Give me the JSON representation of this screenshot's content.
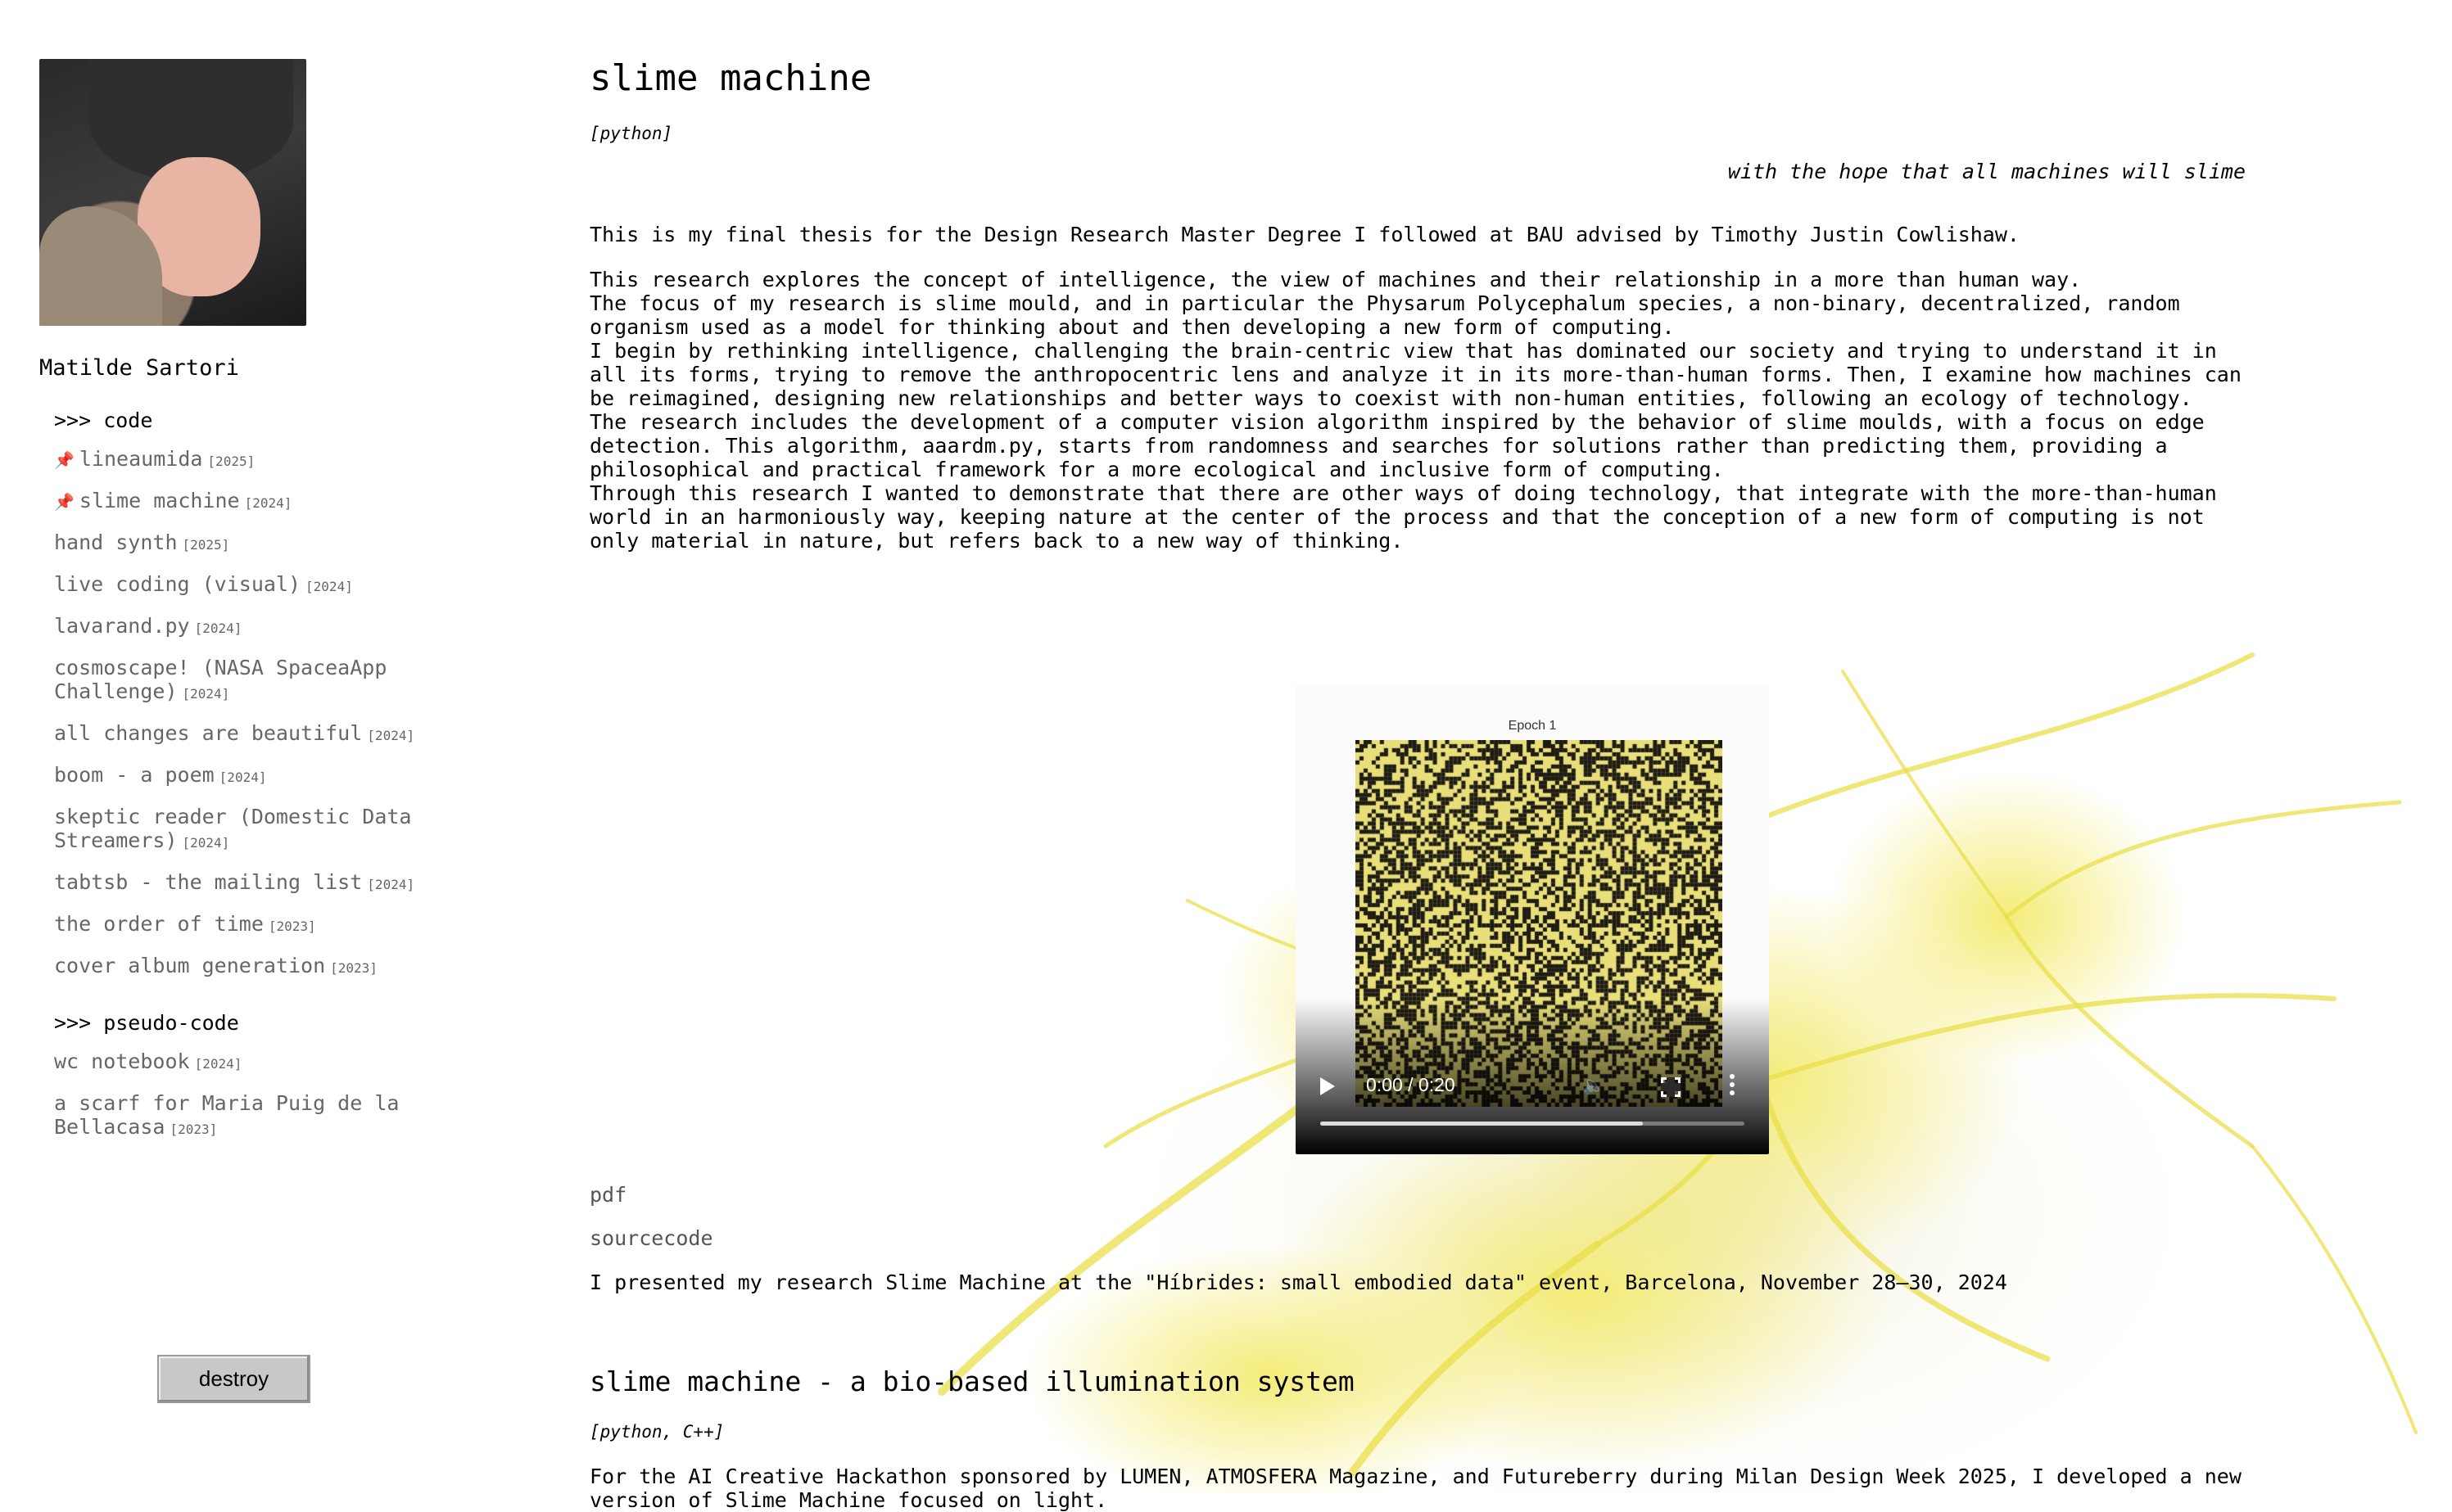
{
  "author": {
    "name": "Matilde Sartori"
  },
  "sidebar": {
    "sections": [
      {
        "heading": ">>> code",
        "items": [
          {
            "label": "lineaumida",
            "year": "[2025]",
            "pinned": true
          },
          {
            "label": "slime machine",
            "year": "[2024]",
            "pinned": true
          },
          {
            "label": "hand synth",
            "year": "[2025]",
            "pinned": false
          },
          {
            "label": "live coding (visual)",
            "year": "[2024]",
            "pinned": false
          },
          {
            "label": "lavarand.py",
            "year": "[2024]",
            "pinned": false
          },
          {
            "label": "cosmoscape! (NASA SpaceaApp Challenge)",
            "year": "[2024]",
            "pinned": false
          },
          {
            "label": "all changes are beautiful",
            "year": "[2024]",
            "pinned": false
          },
          {
            "label": "boom - a poem",
            "year": "[2024]",
            "pinned": false
          },
          {
            "label": "skeptic reader (Domestic Data Streamers)",
            "year": "[2024]",
            "pinned": false
          },
          {
            "label": "tabtsb - the mailing list",
            "year": "[2024]",
            "pinned": false
          },
          {
            "label": "the order of time",
            "year": "[2023]",
            "pinned": false
          },
          {
            "label": "cover album generation",
            "year": "[2023]",
            "pinned": false
          }
        ]
      },
      {
        "heading": ">>> pseudo-code",
        "items": [
          {
            "label": "wc notebook",
            "year": "[2024]",
            "pinned": false
          },
          {
            "label": "a scarf for Maria Puig de la Bellacasa",
            "year": "[2023]",
            "pinned": false
          }
        ]
      }
    ],
    "destroy_label": "destroy"
  },
  "project": {
    "title": "slime machine",
    "languages": "[python]",
    "quote": "with the hope that all machines will slime",
    "intro": "This is my final thesis for the Design Research Master Degree I followed at BAU advised by Timothy Justin Cowlishaw.",
    "paragraphs": [
      "This research explores the concept of intelligence, the view of machines and their relationship in a more than human way.",
      "The focus of my research is slime mould, and in particular the Physarum Polycephalum species, a non-binary, decentralized, random organism used as a model for thinking about and then developing a new form of computing.",
      "I begin by rethinking intelligence, challenging the brain-centric view that has dominated our society and trying to understand it in all its forms, trying to remove the anthropocentric lens and analyze it in its more-than-human forms. Then, I examine how machines can be reimagined, designing new relationships and better ways to coexist with non-human entities, following an ecology of technology.",
      "The research includes the development of a computer vision algorithm inspired by the behavior of slime moulds, with a focus on edge detection. This algorithm, aaardm.py, starts from randomness and searches for solutions rather than predicting them, providing a philosophical and practical framework for a more ecological and inclusive form of computing.",
      "Through this research I wanted to demonstrate that there are other ways of doing technology, that integrate with the more-than-human world in an harmoniously way, keeping nature at the center of the process and that the conception of a new form of computing is not only material in nature, but refers back to a new way of thinking."
    ],
    "video": {
      "frame_label": "Epoch 1",
      "time": "0:00 / 0:20",
      "buffered_fraction": 0.76,
      "grid_colors": {
        "light": "#e8df7a",
        "dark": "#1e1b14"
      }
    },
    "links": {
      "pdf": "pdf",
      "sourcecode": "sourcecode"
    },
    "presented": "I presented my research Slime Machine at the \"Híbrides: small embodied data\" event, Barcelona, November 28–30, 2024"
  },
  "project2": {
    "title": "slime machine - a bio-based illumination system",
    "languages": "[python, C++]",
    "text": "For the AI Creative Hackathon sponsored by LUMEN, ATMOSFERA Magazine, and Futureberry during Milan Design Week 2025, I developed a new version of Slime Machine focused on light."
  },
  "icons": {
    "pin": "pushpin-icon",
    "play": "play-icon",
    "volume": "volume-icon",
    "fullscreen": "fullscreen-icon",
    "more": "more-options-icon"
  }
}
